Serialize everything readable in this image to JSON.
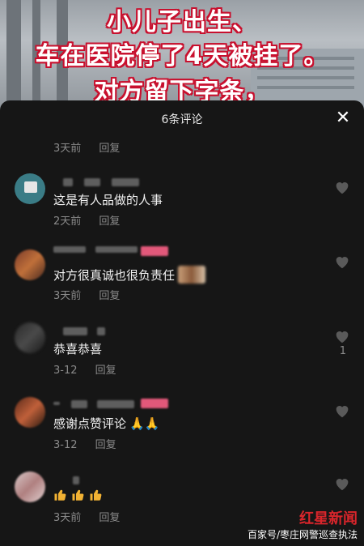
{
  "video": {
    "headline_lines": [
      "小儿子出生、",
      "车在医院停了4天被挂了。",
      "对方留下字条，"
    ]
  },
  "sheet": {
    "title": "6条评论",
    "close_icon": "close-icon"
  },
  "top_meta": {
    "time": "3天前",
    "reply": "回复"
  },
  "comments": [
    {
      "text": "这是有人品做的人事",
      "time": "2天前",
      "reply": "回复",
      "likes": ""
    },
    {
      "text": "对方很真诚也很负责任",
      "time": "3天前",
      "reply": "回复",
      "likes": ""
    },
    {
      "text": "恭喜恭喜",
      "time": "3-12",
      "reply": "回复",
      "likes": "1"
    },
    {
      "text": "感谢点赞评论",
      "emoji": "🙏🙏",
      "time": "3-12",
      "reply": "回复",
      "likes": ""
    },
    {
      "text": "",
      "time": "3天前",
      "reply": "回复",
      "likes": ""
    }
  ],
  "watermark": {
    "source": "百家号/枣庄网警巡查执法",
    "logo": "红星新闻"
  },
  "colors": {
    "background": "#161616",
    "meta": "#8a8a8a",
    "headline_stroke": "#c8102e",
    "heart": "#5a5a5a"
  }
}
